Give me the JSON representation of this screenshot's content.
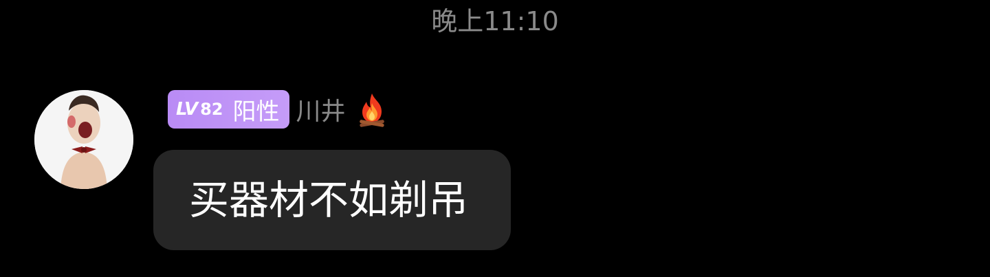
{
  "timestamp": "晚上11:10",
  "message": {
    "sender": {
      "level_prefix": "LV",
      "level_number": "82",
      "level_title": "阳性",
      "username": "川井",
      "badge_icon": "fire-icon",
      "avatar": "avatar-image"
    },
    "text": "买器材不如剃吊"
  },
  "colors": {
    "background": "#000000",
    "bubble": "#262626",
    "badge": "#c09af7",
    "muted_text": "#8a8a8a",
    "message_text": "#ffffff"
  }
}
